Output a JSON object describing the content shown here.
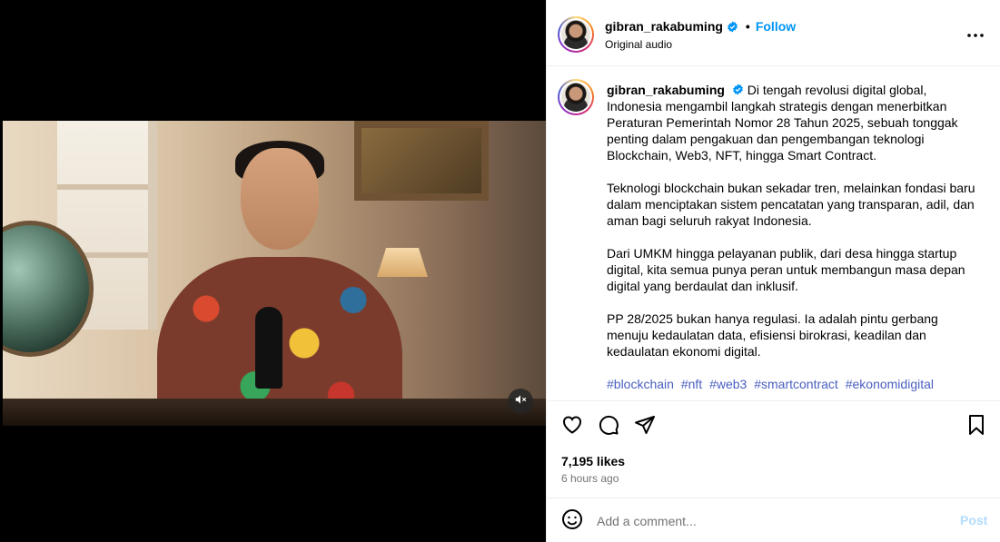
{
  "post": {
    "username": "gibran_rakabuming",
    "follow_label": "Follow",
    "audio": "Original audio",
    "separator": "•",
    "caption": {
      "username": "gibran_rakabuming",
      "paragraphs": [
        "Di tengah revolusi digital global, Indonesia mengambil langkah strategis dengan menerbitkan Peraturan Pemerintah Nomor 28 Tahun 2025, sebuah tonggak penting dalam pengakuan dan pengembangan teknologi Blockchain, Web3, NFT, hingga Smart Contract.",
        "Teknologi blockchain bukan sekadar tren, melainkan fondasi baru dalam menciptakan sistem pencatatan yang transparan, adil, dan aman bagi seluruh rakyat Indonesia.",
        "Dari UMKM hingga pelayanan publik, dari desa hingga startup digital, kita semua punya peran untuk membangun masa depan digital yang berdaulat dan inklusif.",
        "PP 28/2025 bukan hanya regulasi. Ia adalah pintu gerbang menuju kedaulatan data, efisiensi birokrasi, keadilan dan kedaulatan ekonomi digital."
      ],
      "hashtags": [
        "#blockchain",
        "#nft",
        "#web3",
        "#smartcontract",
        "#ekonomidigital"
      ]
    },
    "likes": "7,195 likes",
    "time_ago": "6 hours ago",
    "comment": {
      "placeholder": "Add a comment...",
      "value": "",
      "post_label": "Post"
    }
  },
  "icons": {
    "verified": "verified-badge-icon",
    "more": "more-options-icon",
    "like": "heart-icon",
    "comment": "comment-bubble-icon",
    "share": "paper-plane-icon",
    "save": "bookmark-icon",
    "emoji": "emoji-icon",
    "mute": "muted-speaker-icon"
  },
  "colors": {
    "link_blue": "#0095f6",
    "hashtag": "#4a5fc1",
    "muted_text": "#737373",
    "post_disabled": "#b3dbff"
  }
}
